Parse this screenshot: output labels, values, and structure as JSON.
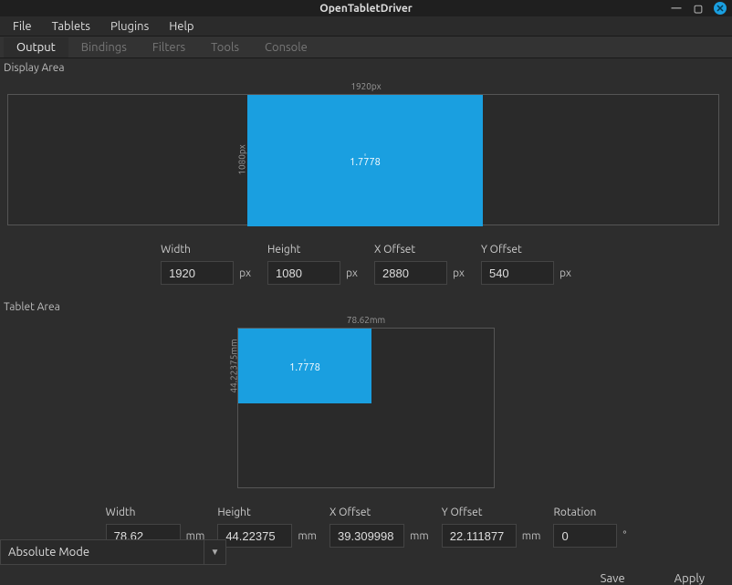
{
  "window": {
    "title": "OpenTabletDriver"
  },
  "menu": {
    "file": "File",
    "tablets": "Tablets",
    "plugins": "Plugins",
    "help": "Help"
  },
  "tabs": {
    "output": "Output",
    "bindings": "Bindings",
    "filters": "Filters",
    "tools": "Tools",
    "console": "Console"
  },
  "displayArea": {
    "title": "Display Area",
    "dimTop": "1920px",
    "dimLeft": "1080px",
    "ratio": "1.7778",
    "fields": {
      "widthLabel": "Width",
      "width": "1920",
      "heightLabel": "Height",
      "height": "1080",
      "xLabel": "X Offset",
      "x": "2880",
      "yLabel": "Y Offset",
      "y": "540",
      "unit": "px"
    }
  },
  "tabletArea": {
    "title": "Tablet Area",
    "dimTop": "78.62mm",
    "dimLeft": "44.22375mm",
    "ratio": "1.7778",
    "fields": {
      "widthLabel": "Width",
      "width": "78.62",
      "heightLabel": "Height",
      "height": "44.22375",
      "xLabel": "X Offset",
      "x": "39.309998",
      "yLabel": "Y Offset",
      "y": "22.111877",
      "rotLabel": "Rotation",
      "rot": "0",
      "unit": "mm",
      "rotUnit": "°"
    }
  },
  "mode": {
    "label": "Absolute Mode"
  },
  "footer": {
    "save": "Save",
    "apply": "Apply"
  }
}
